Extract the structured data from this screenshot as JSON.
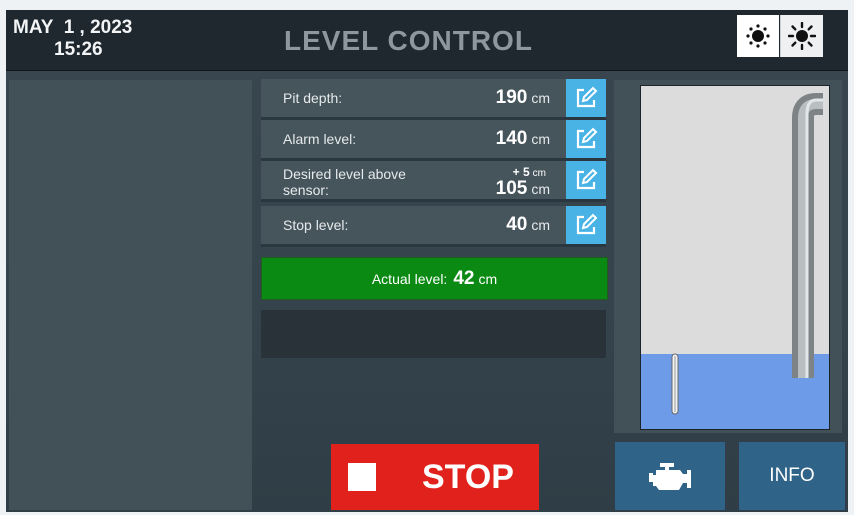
{
  "header": {
    "date": "MAY  1 , 2023",
    "time": "15:26",
    "title": "LEVEL CONTROL",
    "brightness_low_icon": "sun-small-icon",
    "brightness_high_icon": "sun-large-icon"
  },
  "params": [
    {
      "label": "Pit depth:",
      "value": "190",
      "unit": "cm",
      "icon": "edit-icon"
    },
    {
      "label": "Alarm level:",
      "value": "140",
      "unit": "cm",
      "icon": "edit-icon"
    },
    {
      "label": "Desired level above sensor:",
      "offset": "+ 5",
      "offset_unit": "cm",
      "value": "105",
      "unit": "cm",
      "icon": "edit-icon"
    },
    {
      "label": "Stop level:",
      "value": "40",
      "unit": "cm",
      "icon": "edit-icon"
    }
  ],
  "actual": {
    "label": "Actual level:",
    "value": "42",
    "unit": "cm"
  },
  "stop_button": {
    "label": "STOP"
  },
  "info_button": {
    "label": "INFO"
  },
  "pump_button": {
    "icon": "engine-icon"
  },
  "tank": {
    "water_level_fraction": 0.22
  },
  "colors": {
    "header_bg": "#1f282f",
    "edit_button": "#4ab3e5",
    "actual_ok": "#0b8a13",
    "stop_red": "#e0211c",
    "water": "#6d9be8",
    "nav_button": "#2f6387"
  }
}
